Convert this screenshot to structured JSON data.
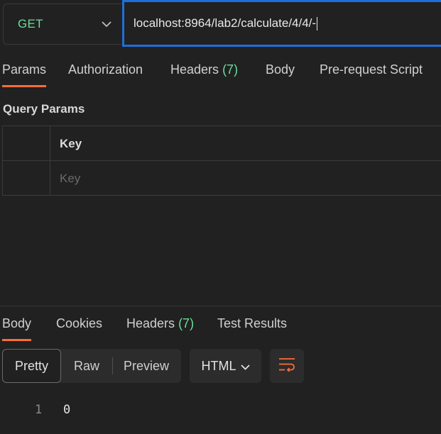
{
  "request": {
    "method": "GET",
    "url": "localhost:8964/lab2/calculate/4/4/-"
  },
  "request_tabs": [
    {
      "label": "Params",
      "count": ""
    },
    {
      "label": "Authorization",
      "count": ""
    },
    {
      "label": "Headers",
      "count": "(7)"
    },
    {
      "label": "Body",
      "count": ""
    },
    {
      "label": "Pre-request Script",
      "count": ""
    }
  ],
  "active_request_tab": "Params",
  "query_params": {
    "title": "Query Params",
    "column_key": "Key",
    "key_placeholder": "Key"
  },
  "response_tabs": [
    {
      "label": "Body",
      "count": ""
    },
    {
      "label": "Cookies",
      "count": ""
    },
    {
      "label": "Headers",
      "count": "(7)"
    },
    {
      "label": "Test Results",
      "count": ""
    }
  ],
  "active_response_tab": "Body",
  "view_modes": [
    "Pretty",
    "Raw",
    "Preview"
  ],
  "active_view_mode": "Pretty",
  "format": "HTML",
  "response_body": {
    "lines": [
      {
        "number": "1",
        "content": "0"
      }
    ]
  },
  "colors": {
    "accent": "#ff6c37",
    "method_get": "#6bdd9a",
    "url_focus": "#1e6fd9",
    "background": "#212121"
  },
  "icons": {
    "method_dropdown": "chevron-down-icon",
    "format_dropdown": "chevron-down-icon",
    "wrap": "wrap-lines-icon"
  }
}
